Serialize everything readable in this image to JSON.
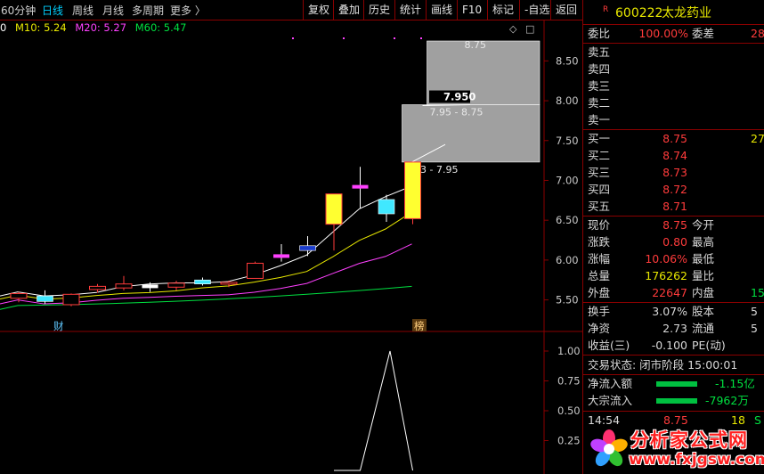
{
  "toolbar": {
    "period_60": "60分钟",
    "day": "日线",
    "week": "周线",
    "month": "月线",
    "multi": "多周期",
    "more": "更多 〉",
    "right": [
      "复权",
      "叠加",
      "历史",
      "统计",
      "画线",
      "F10",
      "标记",
      "-自选",
      "返回"
    ]
  },
  "ma": {
    "m5": "0",
    "m10": "M10: 5.24",
    "m20": "M20: 5.27",
    "m60": "M60: 5.47",
    "colors": {
      "m5": "#ffffff",
      "m10": "#e8e800",
      "m20": "#ff40ff",
      "m60": "#00e040"
    }
  },
  "chart_data": {
    "type": "candlestick",
    "y_axis_ticks": [
      "8.50",
      "8.00",
      "7.50",
      "7.00",
      "6.50",
      "6.00",
      "5.50"
    ],
    "y_range": [
      5.35,
      8.75
    ],
    "candles": [
      {
        "o": 5.52,
        "h": 5.6,
        "l": 5.47,
        "c": 5.58,
        "kind": "down"
      },
      {
        "o": 5.55,
        "h": 5.62,
        "l": 5.45,
        "c": 5.48,
        "kind": "cyan"
      },
      {
        "o": 5.44,
        "h": 5.58,
        "l": 5.42,
        "c": 5.57,
        "kind": "up"
      },
      {
        "o": 5.63,
        "h": 5.7,
        "l": 5.59,
        "c": 5.67,
        "kind": "up"
      },
      {
        "o": 5.65,
        "h": 5.8,
        "l": 5.62,
        "c": 5.7,
        "kind": "up"
      },
      {
        "o": 5.67,
        "h": 5.72,
        "l": 5.6,
        "c": 5.67,
        "kind": "doji"
      },
      {
        "o": 5.66,
        "h": 5.74,
        "l": 5.62,
        "c": 5.71,
        "kind": "up"
      },
      {
        "o": 5.75,
        "h": 5.78,
        "l": 5.68,
        "c": 5.7,
        "kind": "cyan"
      },
      {
        "o": 5.71,
        "h": 5.74,
        "l": 5.66,
        "c": 5.72,
        "kind": "up"
      },
      {
        "o": 5.77,
        "h": 5.98,
        "l": 5.77,
        "c": 5.96,
        "kind": "up"
      },
      {
        "o": 6.05,
        "h": 6.2,
        "l": 5.98,
        "c": 6.05,
        "kind": "pdoji"
      },
      {
        "o": 6.18,
        "h": 6.3,
        "l": 6.05,
        "c": 6.12,
        "kind": "blue"
      },
      {
        "o": 6.45,
        "h": 6.65,
        "l": 6.12,
        "c": 6.83,
        "kind": "yel"
      },
      {
        "o": 6.95,
        "h": 7.17,
        "l": 6.65,
        "c": 6.92,
        "kind": "pdoji"
      },
      {
        "o": 6.76,
        "h": 6.82,
        "l": 6.48,
        "c": 6.58,
        "kind": "cyan"
      },
      {
        "o": 6.52,
        "h": 7.23,
        "l": 6.45,
        "c": 7.23,
        "kind": "yel"
      }
    ],
    "limit_boxes": [
      {
        "low": 7.23,
        "high": 7.95,
        "label": "7.23 - 7.95"
      },
      {
        "low": 7.95,
        "high": 8.75,
        "label": "7.95 - 8.75"
      },
      {
        "low": 8.75,
        "high": 8.75,
        "label": "8.75"
      }
    ],
    "price_tag": "7.950",
    "markers": [
      "财",
      "榜"
    ],
    "indicator_ticks": [
      "1.00",
      "0.75",
      "0.50",
      "0.25"
    ],
    "indicator_values": [
      0,
      0,
      0,
      0,
      0,
      0,
      0,
      0,
      0,
      0,
      0,
      0,
      0,
      0,
      1,
      0
    ]
  },
  "quote": {
    "badge": "R",
    "code": "600222",
    "name": "太龙药业",
    "weibi_label": "委比",
    "weibi": "100.00%",
    "weicha_label": "委差",
    "weicha": "28",
    "sell": [
      {
        "label": "卖五",
        "price": "",
        "vol": ""
      },
      {
        "label": "卖四",
        "price": "",
        "vol": ""
      },
      {
        "label": "卖三",
        "price": "",
        "vol": ""
      },
      {
        "label": "卖二",
        "price": "",
        "vol": ""
      },
      {
        "label": "卖一",
        "price": "",
        "vol": ""
      }
    ],
    "buy": [
      {
        "label": "买一",
        "price": "8.75",
        "vol": "27"
      },
      {
        "label": "买二",
        "price": "8.74",
        "vol": ""
      },
      {
        "label": "买三",
        "price": "8.73",
        "vol": ""
      },
      {
        "label": "买四",
        "price": "8.72",
        "vol": ""
      },
      {
        "label": "买五",
        "price": "8.71",
        "vol": ""
      }
    ],
    "stats": [
      {
        "l1": "现价",
        "v1": "8.75",
        "c1": "red",
        "l2": "今开",
        "v2": ""
      },
      {
        "l1": "涨跌",
        "v1": "0.80",
        "c1": "red",
        "l2": "最高",
        "v2": ""
      },
      {
        "l1": "涨幅",
        "v1": "10.06%",
        "c1": "red",
        "l2": "最低",
        "v2": ""
      },
      {
        "l1": "总量",
        "v1": "176262",
        "c1": "yel",
        "l2": "量比",
        "v2": ""
      },
      {
        "l1": "外盘",
        "v1": "22647",
        "c1": "red",
        "l2": "内盘",
        "v2": "15",
        "c2": "grn"
      }
    ],
    "stats2": [
      {
        "l1": "换手",
        "v1": "3.07%",
        "c1": "plain",
        "l2": "股本",
        "v2": "5"
      },
      {
        "l1": "净资",
        "v1": "2.73",
        "c1": "plain",
        "l2": "流通",
        "v2": "5"
      },
      {
        "l1": "收益(三)",
        "v1": "-0.100",
        "c1": "plain",
        "l2": "PE(动)",
        "v2": ""
      }
    ],
    "trade_status": "交易状态: 闭市阶段 15:00:01",
    "netflow_label": "净流入额",
    "netflow": "-1.15亿",
    "block_label": "大宗流入",
    "block": "-7962万",
    "tick_time": "14:54",
    "tick_price": "8.75",
    "tick_vol": "18",
    "tick_side": "S"
  },
  "watermark": {
    "name": "分析家公式网",
    "url": "www.fxjgsw.com"
  }
}
